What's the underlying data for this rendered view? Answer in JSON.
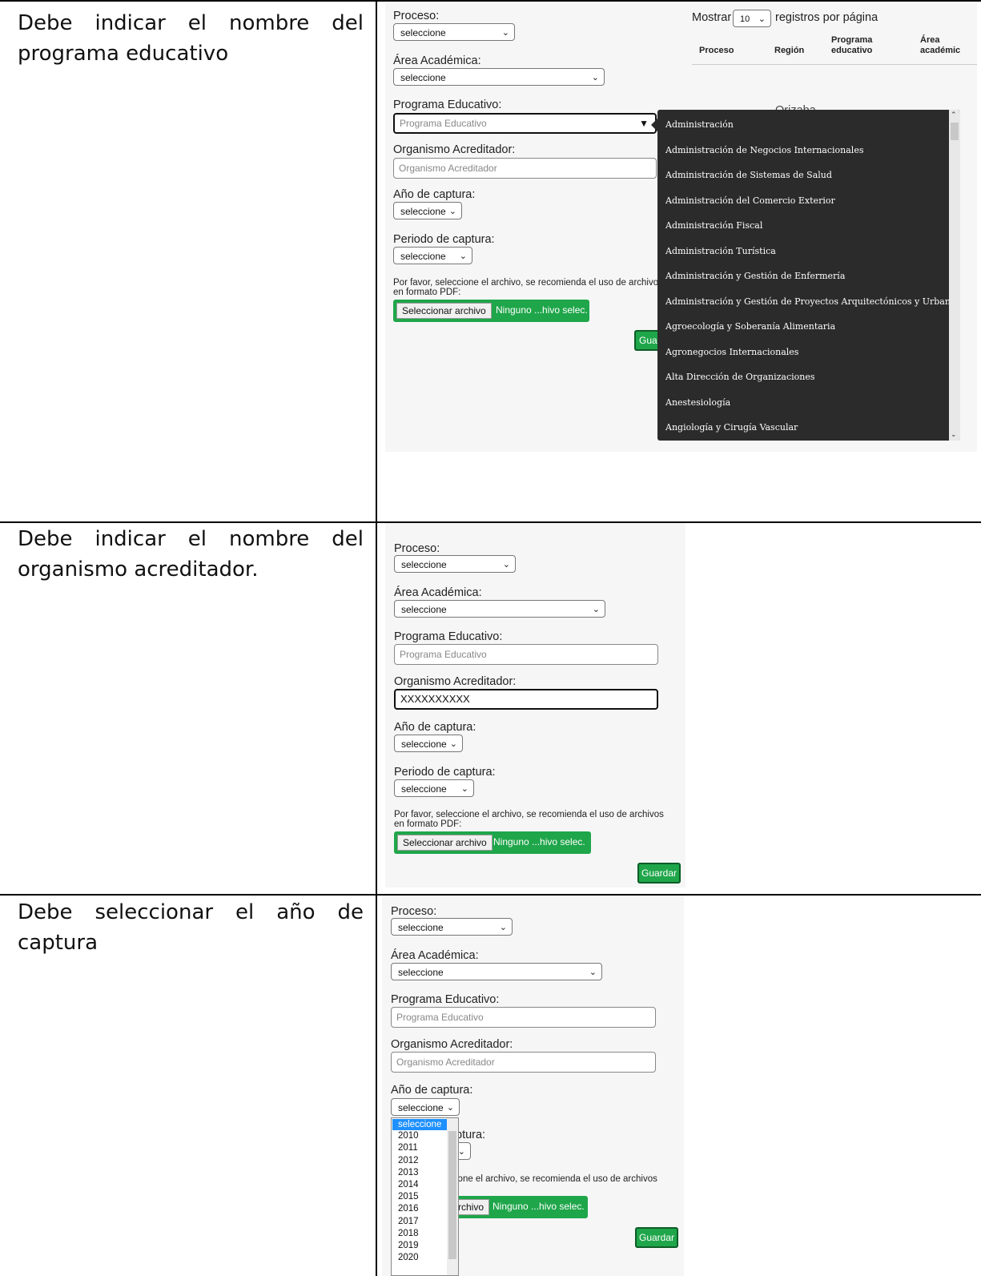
{
  "rows": [
    {
      "description": "Debe indicar el nombre del programa educativo",
      "desc_first_line": "Debe indicar el nombre del",
      "desc_rest": "programa educativo"
    },
    {
      "description": "Debe indicar el nombre del organismo acreditador.",
      "desc_first_line": "Debe indicar el nombre del",
      "desc_rest": "organismo acreditador."
    },
    {
      "description": "Debe seleccionar el año de captura",
      "desc_first_line": "Debe seleccionar el año de",
      "desc_rest": "captura"
    }
  ],
  "form": {
    "proceso_label": "Proceso:",
    "area_label": "Área Académica:",
    "programa_label": "Programa Educativo:",
    "organismo_label": "Organismo Acreditador:",
    "anio_label": "Año de captura:",
    "periodo_label": "Periodo de captura:",
    "select_value": "seleccione",
    "programa_placeholder": "Programa Educativo",
    "organismo_placeholder": "Organismo Acreditador",
    "organismo_value": "XXXXXXXXXX",
    "file_note": "Por favor, seleccione el archivo, se recomienda el uso de archivos en formato PDF:",
    "file_button": "Seleccionar archivo",
    "file_status": "Ninguno ...hivo selec.",
    "save_label": "Guardar",
    "save_partial": "Guar"
  },
  "table_preview": {
    "show_label": "Mostrar",
    "page_size": "10",
    "per_page_label": "registros por página",
    "headers": [
      "Proceso",
      "Región",
      "Programa educativo",
      "Área académic"
    ],
    "partial_cell": "Orizaba"
  },
  "programa_options": [
    "Administración",
    "Administración de Negocios Internacionales",
    "Administración de Sistemas de Salud",
    "Administración del Comercio Exterior",
    "Administración Fiscal",
    "Administración Turística",
    "Administración y Gestión de Enfermería",
    "Administración y Gestión de Proyectos Arquitectónicos y Urbanos",
    "Agroecología y Soberanía Alimentaria",
    "Agronegocios Internacionales",
    "Alta Dirección de Organizaciones",
    "Anestesiología",
    "Angiología y Cirugía Vascular"
  ],
  "year_options": [
    "seleccione",
    "2010",
    "2011",
    "2012",
    "2013",
    "2014",
    "2015",
    "2016",
    "2017",
    "2018",
    "2019",
    "2020"
  ],
  "row3_partial": {
    "periodo_label_tail": "ptura:",
    "file_note_tail": "ione el archivo, se recomienda el uso de archivos",
    "file_button_tail": "rchivo"
  },
  "colors": {
    "green": "#1fa64a",
    "dropdown_bg": "#2b2b2b",
    "highlight": "#1e90ff"
  }
}
